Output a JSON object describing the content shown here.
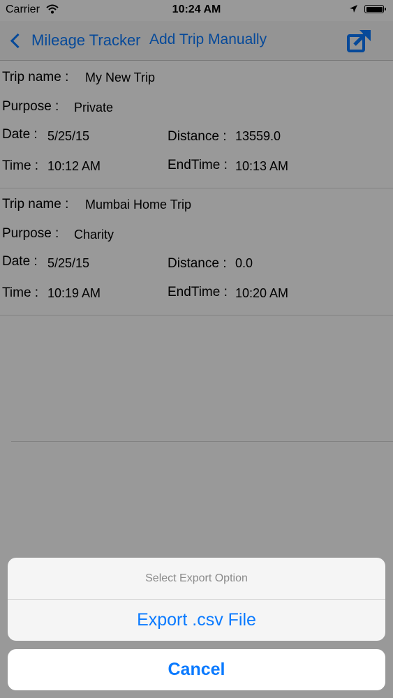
{
  "status_bar": {
    "carrier": "Carrier",
    "time": "10:24 AM"
  },
  "nav": {
    "back_label": "Mileage Tracker",
    "title": "Add Trip Manually",
    "share_icon": "share-export-icon",
    "accent_color": "#0a7aff"
  },
  "labels": {
    "trip_name": "Trip name :",
    "purpose": "Purpose :",
    "date": "Date :",
    "distance": "Distance :",
    "time": "Time :",
    "end_time": "EndTime :"
  },
  "trips": [
    {
      "name": "My New Trip",
      "purpose": "Private",
      "date": "5/25/15",
      "distance": "13559.0",
      "time": "10:12 AM",
      "end_time": "10:13 AM"
    },
    {
      "name": "Mumbai Home Trip",
      "purpose": "Charity",
      "date": "5/25/15",
      "distance": "0.0",
      "time": "10:19 AM",
      "end_time": "10:20 AM"
    }
  ],
  "action_sheet": {
    "title": "Select Export Option",
    "export_label": "Export .csv File",
    "cancel_label": "Cancel"
  }
}
